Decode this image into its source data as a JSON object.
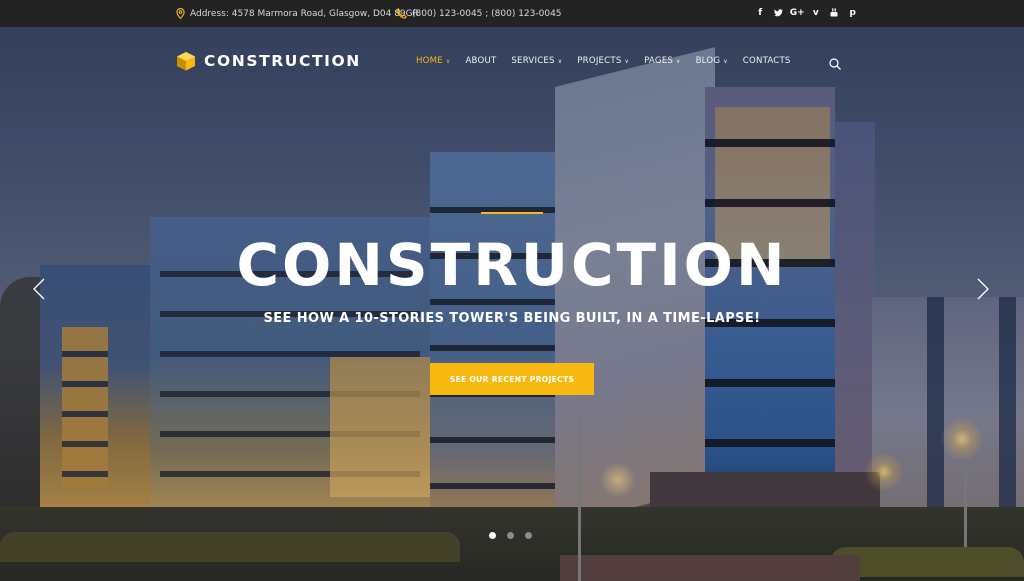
{
  "topbar": {
    "address": "Address: 4578 Marmora Road, Glasgow, D04 89GR",
    "phones": "(800) 123-0045 ; (800) 123-0045",
    "social": [
      {
        "name": "facebook",
        "glyph": "f"
      },
      {
        "name": "twitter",
        "glyph": "t"
      },
      {
        "name": "google-plus",
        "glyph": "G+"
      },
      {
        "name": "vimeo",
        "glyph": "v"
      },
      {
        "name": "youtube",
        "glyph": "▶"
      },
      {
        "name": "pinterest",
        "glyph": "p"
      }
    ]
  },
  "header": {
    "logo_text": "CONSTRUCTION",
    "nav": [
      {
        "label": "HOME",
        "has_dropdown": true,
        "active": true
      },
      {
        "label": "ABOUT",
        "has_dropdown": false,
        "active": false
      },
      {
        "label": "SERVICES",
        "has_dropdown": true,
        "active": false
      },
      {
        "label": "PROJECTS",
        "has_dropdown": true,
        "active": false
      },
      {
        "label": "PAGES",
        "has_dropdown": true,
        "active": false
      },
      {
        "label": "BLOG",
        "has_dropdown": true,
        "active": false
      },
      {
        "label": "CONTACTS",
        "has_dropdown": false,
        "active": false
      }
    ],
    "chevron_glyph": "∨",
    "search_icon": "search-icon"
  },
  "hero": {
    "title": "CONSTRUCTION",
    "subtitle": "SEE HOW A 10-STORIES TOWER'S BEING BUILT, IN A TIME-LAPSE!",
    "cta_label": "SEE OUR RECENT PROJECTS",
    "slides_total": 3,
    "active_slide": 1
  },
  "colors": {
    "accent": "#f5b914",
    "topbar_bg": "#232324",
    "text_light": "#ffffff"
  }
}
